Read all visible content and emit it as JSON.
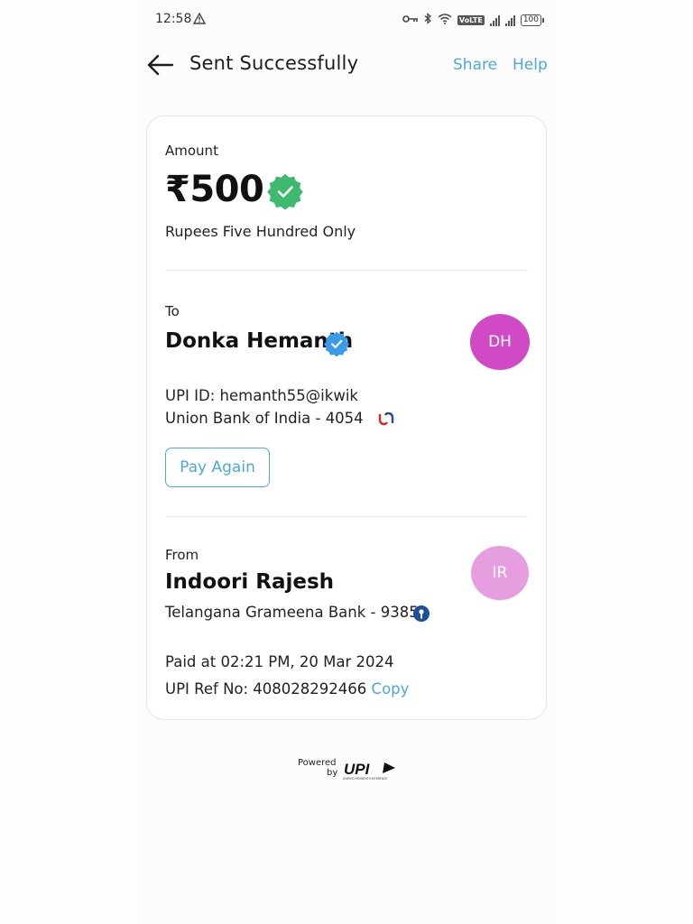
{
  "status_bar": {
    "time": "12:58",
    "lte_label": "VoLTE",
    "battery": "100"
  },
  "header": {
    "title": "Sent Successfully",
    "share": "Share",
    "help": "Help"
  },
  "amount_section": {
    "label": "Amount",
    "amount": "₹500",
    "in_words": "Rupees Five Hundred Only"
  },
  "to_section": {
    "label": "To",
    "name": "Donka Hemanth",
    "avatar_initials": "DH",
    "upi_id": "UPI ID: hemanth55@ikwik",
    "bank": "Union Bank of India - 4054",
    "pay_again": "Pay Again"
  },
  "from_section": {
    "label": "From",
    "name": "Indoori Rajesh",
    "avatar_initials": "IR",
    "bank": "Telangana Grameena Bank - 9385"
  },
  "transaction": {
    "paid_at": "Paid at 02:21 PM, 20 Mar 2024",
    "ref_no": "UPI Ref No: 408028292466",
    "copy": "Copy"
  },
  "footer": {
    "powered": "Powered",
    "by": "by",
    "upi_logo_text": "UPI",
    "upi_tagline": "UNIFIED PAYMENTS INTERFACE"
  },
  "colors": {
    "accent": "#4ba9d9",
    "success_green": "#3dba6e",
    "verified_blue": "#3a9be8",
    "avatar_to": "#cf4ac4",
    "avatar_from": "#e69ee0"
  }
}
